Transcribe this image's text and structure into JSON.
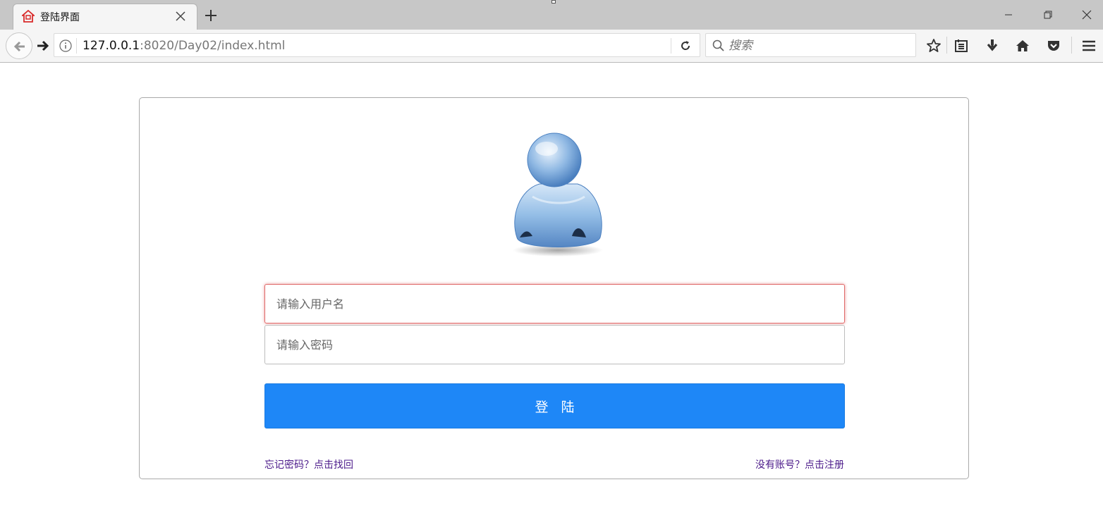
{
  "browser": {
    "tab_title": "登陆界面",
    "url_host": "127.0.0.1",
    "url_rest": ":8020/Day02/index.html",
    "search_placeholder": "搜索"
  },
  "login": {
    "username_placeholder": "请输入用户名",
    "password_placeholder": "请输入密码",
    "login_label": "登陆",
    "forgot_link": "忘记密码？点击找回",
    "register_link": "没有账号？点击注册"
  },
  "colors": {
    "button": "#1e87f7",
    "link": "#4b1a8a",
    "focus_border": "#e06a6a"
  }
}
